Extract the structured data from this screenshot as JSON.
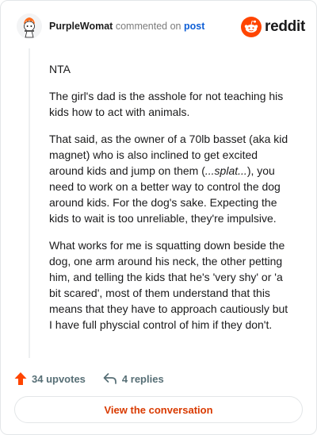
{
  "header": {
    "username": "PurpleWomat",
    "action_text": "commented on",
    "target_link": "post",
    "brand_wordmark": "reddit"
  },
  "comment": {
    "paragraphs": [
      {
        "text": "NTA"
      },
      {
        "text": "The girl's dad is the asshole for not teaching his kids how to act with animals."
      },
      {
        "pre": "That said, as the owner of a 70lb basset (aka kid magnet) who is also inclined to get excited around kids and jump on them (",
        "emph": "...splat...",
        "post": "), you need to work on a better way to control the dog around kids. For the dog's sake. Expecting the kids to wait is too unreliable, they're impulsive."
      },
      {
        "text": "What works for me is squatting down beside the dog, one arm around his neck, the other petting him, and telling the kids that he's 'very shy' or 'a bit scared', most of them understand that this means that they have to approach cautiously but I have full physcial control of him if they don't."
      }
    ]
  },
  "actions": {
    "upvotes_label": "34 upvotes",
    "replies_label": "4 replies"
  },
  "view_button_label": "View the conversation",
  "colors": {
    "accent": "#ff4500",
    "link": "#0f5fd6",
    "button_text": "#d93a00"
  },
  "icons": [
    "avatar-icon",
    "reddit-logo-icon",
    "upvote-arrow-icon",
    "reply-arrow-icon"
  ]
}
